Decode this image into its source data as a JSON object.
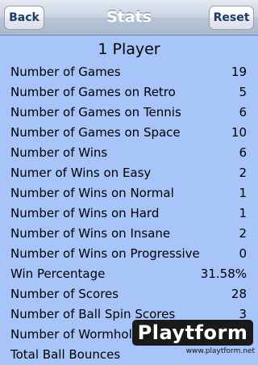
{
  "navbar": {
    "back_label": "Back",
    "title": "Stats",
    "reset_label": "Reset"
  },
  "section_title": "1 Player",
  "stats": [
    {
      "label": "Number of Games",
      "value": "19"
    },
    {
      "label": "Number of Games on Retro",
      "value": "5"
    },
    {
      "label": "Number of Games on Tennis",
      "value": "6"
    },
    {
      "label": "Number of Games on Space",
      "value": "10"
    },
    {
      "label": "Number of Wins",
      "value": "6"
    },
    {
      "label": "Numer of Wins on Easy",
      "value": "2"
    },
    {
      "label": "Number of Wins on Normal",
      "value": "1"
    },
    {
      "label": "Number of Wins on Hard",
      "value": "1"
    },
    {
      "label": "Number of Wins on Insane",
      "value": "2"
    },
    {
      "label": "Number of Wins on Progressive",
      "value": "0"
    },
    {
      "label": "Win Percentage",
      "value": "31.58%"
    },
    {
      "label": "Number of Scores",
      "value": "28"
    },
    {
      "label": "Number of Ball Spin Scores",
      "value": "3"
    },
    {
      "label": "Number of Wormhole",
      "value": ""
    },
    {
      "label": "Total Ball Bounces",
      "value": ""
    }
  ],
  "watermark": {
    "brand": "Playtform",
    "url": "www.playtform.net"
  }
}
